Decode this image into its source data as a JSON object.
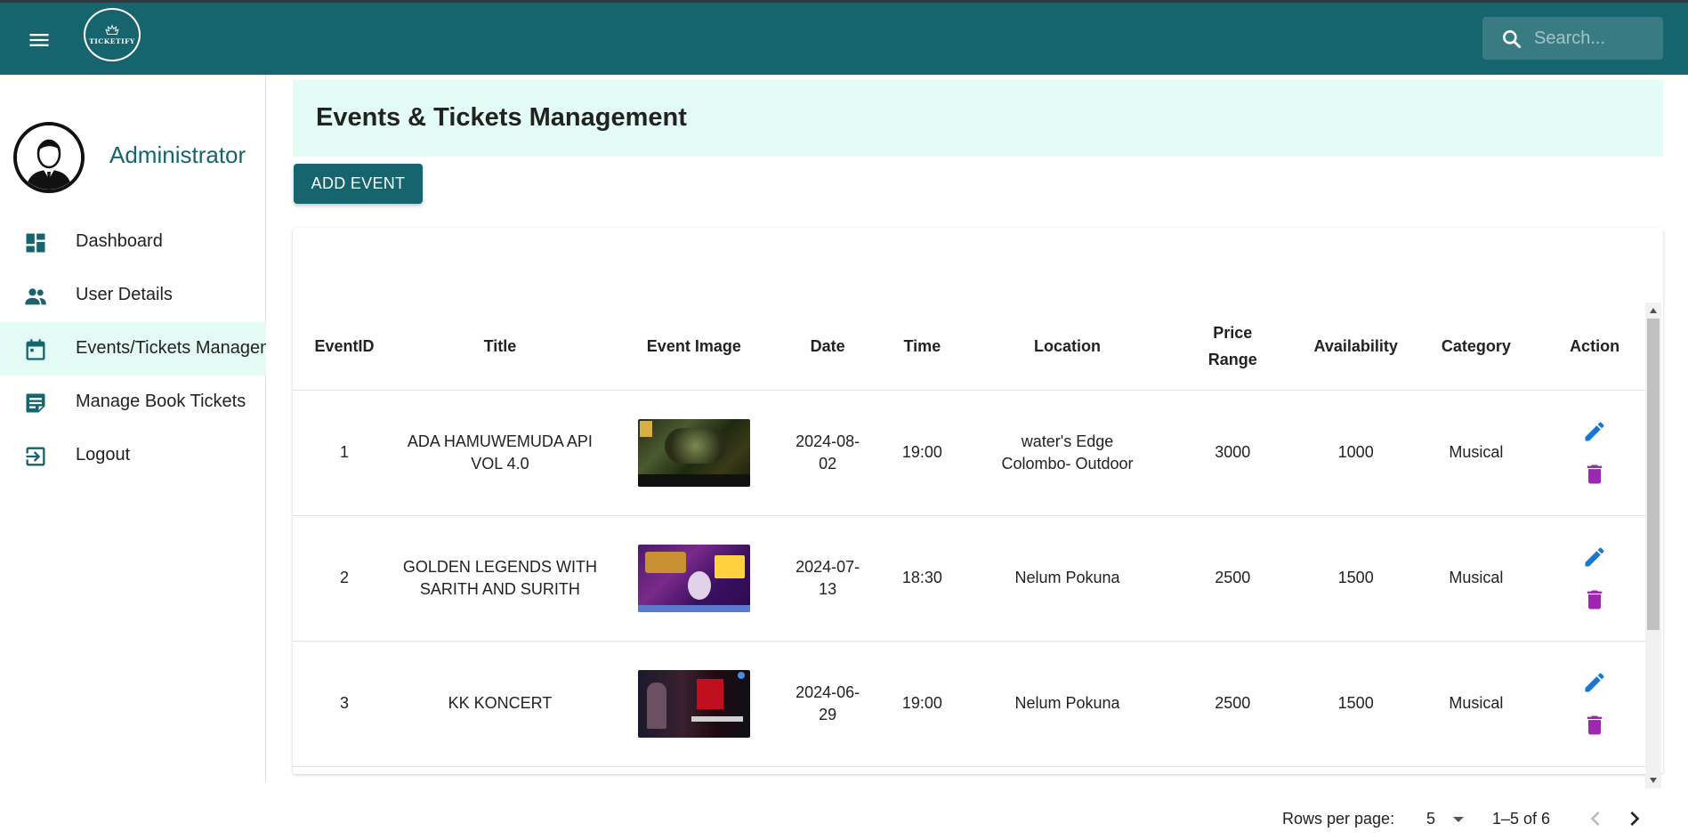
{
  "app": {
    "logo_text": "TICKETIFY",
    "search_placeholder": "Search..."
  },
  "sidebar": {
    "profile_name": "Administrator",
    "items": [
      {
        "label": "Dashboard",
        "icon": "dashboard-icon",
        "active": false
      },
      {
        "label": "User Details",
        "icon": "people-icon",
        "active": false
      },
      {
        "label": "Events/Tickets Management",
        "icon": "calendar-icon",
        "active": true
      },
      {
        "label": "Manage Book Tickets",
        "icon": "note-icon",
        "active": false
      },
      {
        "label": "Logout",
        "icon": "logout-icon",
        "active": false
      }
    ]
  },
  "main": {
    "title": "Events & Tickets Management",
    "add_button": "ADD EVENT"
  },
  "table": {
    "headers": [
      "EventID",
      "Title",
      "Event Image",
      "Date",
      "Time",
      "Location",
      "Price Range",
      "Availability",
      "Category",
      "Action"
    ],
    "rows": [
      {
        "id": "1",
        "title": "ADA HAMUWEMUDA API VOL 4.0",
        "date": "2024-08-02",
        "time": "19:00",
        "location": "water's Edge Colombo- Outdoor",
        "price": "3000",
        "availability": "1000",
        "category": "Musical"
      },
      {
        "id": "2",
        "title": "GOLDEN LEGENDS WITH SARITH AND SURITH",
        "date": "2024-07-13",
        "time": "18:30",
        "location": "Nelum Pokuna",
        "price": "2500",
        "availability": "1500",
        "category": "Musical"
      },
      {
        "id": "3",
        "title": "KK KONCERT",
        "date": "2024-06-29",
        "time": "19:00",
        "location": "Nelum Pokuna",
        "price": "2500",
        "availability": "1500",
        "category": "Musical"
      }
    ]
  },
  "pagination": {
    "rows_per_page_label": "Rows per page:",
    "rows_per_page_value": "5",
    "range": "1–5 of 6"
  },
  "colors": {
    "brand": "#16646e",
    "header_bg": "#e3fdf6",
    "edit": "#1976d2",
    "delete": "#9c27b0"
  }
}
